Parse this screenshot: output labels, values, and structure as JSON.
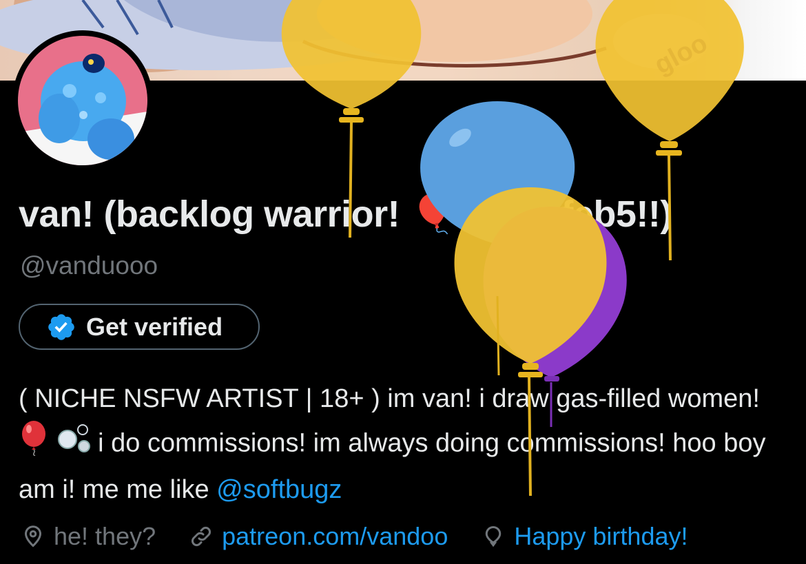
{
  "profile": {
    "display_name": "van! (backlog warrior! 🎈 bday feb5!!)",
    "handle": "@vanduooo",
    "verify_button": "Get verified",
    "bio": {
      "part1": "( NICHE NSFW ARTIST | 18+ ) im van! i draw gas-filled women! ",
      "part2": " i do commissions! im always doing commissions! hoo boy am i! me me like ",
      "mention": "@softbugz",
      "emoji_1": "balloon-emoji",
      "emoji_2": "bubbles-emoji"
    },
    "meta": {
      "pronouns": "he! they?",
      "link": "patreon.com/vandoo",
      "birthday": "Happy birthday!"
    }
  },
  "colors": {
    "background": "#000000",
    "text": "#e7e9ea",
    "secondary": "#71767b",
    "accent": "#1d9bf0",
    "balloon_yellow": "#f1c232",
    "balloon_blue": "#5a9fde",
    "balloon_purple": "#8b3ac9"
  }
}
